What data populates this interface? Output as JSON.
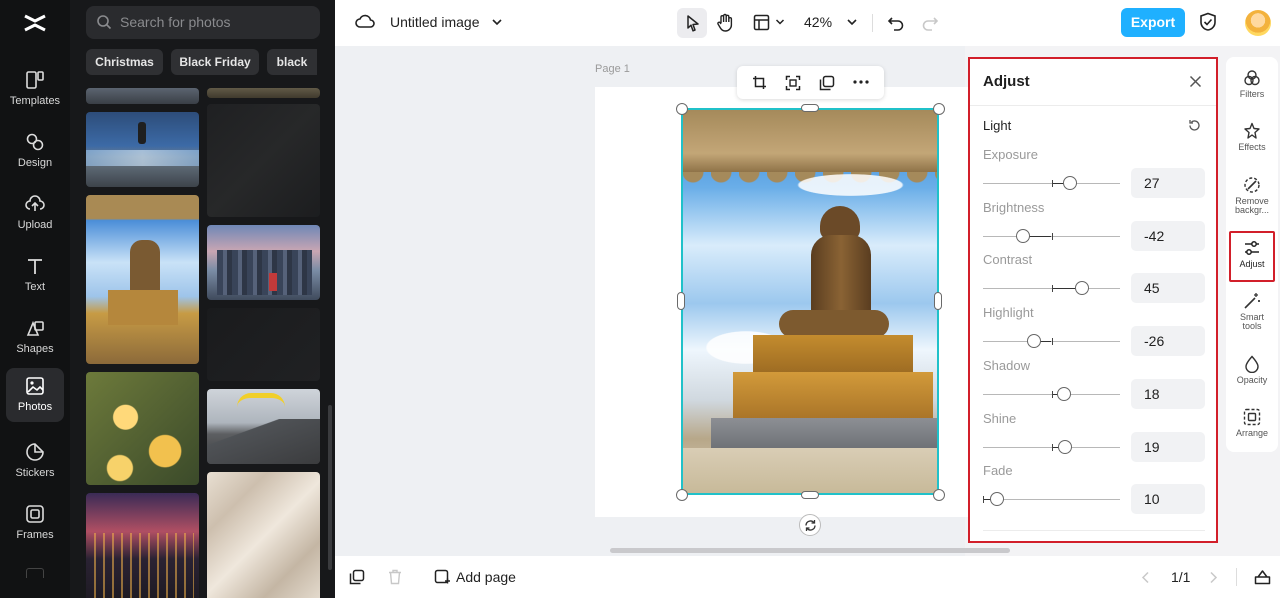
{
  "nav": {
    "items": [
      {
        "label": "Templates",
        "icon": "templates-icon"
      },
      {
        "label": "Design",
        "icon": "design-icon"
      },
      {
        "label": "Upload",
        "icon": "upload-icon"
      },
      {
        "label": "Text",
        "icon": "text-icon"
      },
      {
        "label": "Shapes",
        "icon": "shapes-icon"
      },
      {
        "label": "Photos",
        "icon": "photos-icon",
        "active": true
      },
      {
        "label": "Stickers",
        "icon": "stickers-icon"
      },
      {
        "label": "Frames",
        "icon": "frames-icon"
      }
    ]
  },
  "photos": {
    "search_placeholder": "Search for photos",
    "chips": [
      "Christmas",
      "Black Friday",
      "black"
    ]
  },
  "topbar": {
    "title": "Untitled image",
    "zoom": "42%",
    "export_label": "Export"
  },
  "canvas": {
    "page_label": "Page 1"
  },
  "adjust": {
    "title": "Adjust",
    "section": "Light",
    "sliders": [
      {
        "label": "Exposure",
        "value": "27"
      },
      {
        "label": "Brightness",
        "value": "-42"
      },
      {
        "label": "Contrast",
        "value": "45"
      },
      {
        "label": "Highlight",
        "value": "-26"
      },
      {
        "label": "Shadow",
        "value": "18"
      },
      {
        "label": "Shine",
        "value": "19"
      },
      {
        "label": "Fade",
        "value": "10"
      }
    ]
  },
  "righttools": {
    "filters": "Filters",
    "effects": "Effects",
    "remove_bg_1": "Remove",
    "remove_bg_2": "backgr...",
    "adjust": "Adjust",
    "smart_1": "Smart",
    "smart_2": "tools",
    "opacity": "Opacity",
    "arrange": "Arrange"
  },
  "bottombar": {
    "add_page": "Add page",
    "page_count": "1/1"
  },
  "colors": {
    "accent": "#1fb0ff",
    "highlight_border": "#d21f2a",
    "selection": "#20c1c9"
  }
}
